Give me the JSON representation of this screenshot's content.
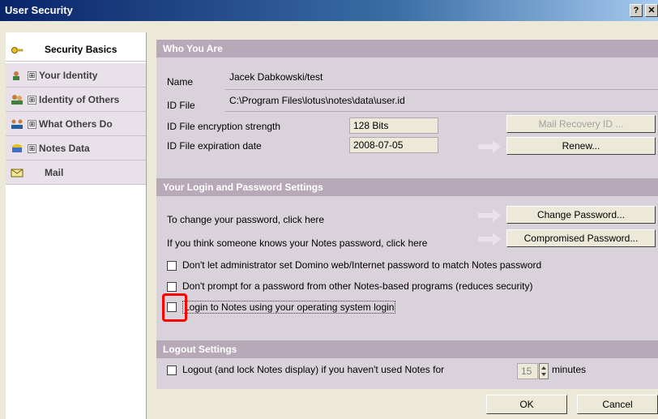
{
  "window": {
    "title": "User Security",
    "help_label": "?",
    "close_label": "✕"
  },
  "nav": {
    "items": [
      {
        "label": "Security Basics",
        "icon": "key-icon",
        "expand": ""
      },
      {
        "label": "Your Identity",
        "icon": "id-card-icon",
        "expand": "⊞"
      },
      {
        "label": "Identity of Others",
        "icon": "people-icon",
        "expand": "⊞"
      },
      {
        "label": "What Others Do",
        "icon": "group-icon",
        "expand": "⊞"
      },
      {
        "label": "Notes Data",
        "icon": "data-icon",
        "expand": "⊞"
      },
      {
        "label": "Mail",
        "icon": "mail-icon",
        "expand": ""
      }
    ]
  },
  "who_you_are": {
    "header": "Who You Are",
    "name_label": "Name",
    "name_value": "Jacek Dabkowski/test",
    "idfile_label": "ID File",
    "idfile_value": "C:\\Program Files\\lotus\\notes\\data\\user.id",
    "strength_label": "ID File encryption strength",
    "strength_value": "128 Bits",
    "expiration_label": "ID File expiration date",
    "expiration_value": "2008-07-05",
    "mail_recovery_button": "Mail Recovery ID ...",
    "renew_button": "Renew..."
  },
  "login": {
    "header": "Your Login and Password Settings",
    "change_text": "To change your password, click here",
    "change_button": "Change Password...",
    "compromised_text": "If you think someone knows your Notes password, click here",
    "compromised_button": "Compromised Password...",
    "checkboxes": [
      {
        "label": "Don't let administrator set Domino web/Internet password to match Notes password",
        "checked": false
      },
      {
        "label": "Don't prompt for a password from other Notes-based programs (reduces security)",
        "checked": false
      },
      {
        "label": "Login to Notes using your operating system login",
        "checked": false
      }
    ]
  },
  "logout": {
    "header": "Logout Settings",
    "checkbox_label": "Logout (and lock Notes display) if you haven't used Notes for",
    "minutes_value": "15",
    "minutes_label": "minutes"
  },
  "footer": {
    "ok_button": "OK",
    "cancel_button": "Cancel"
  },
  "colors": {
    "section_header": "#b8a9b8",
    "section_body": "#d9d2da",
    "nav_item": "#e8e1ea",
    "highlight": "#ff0000"
  }
}
